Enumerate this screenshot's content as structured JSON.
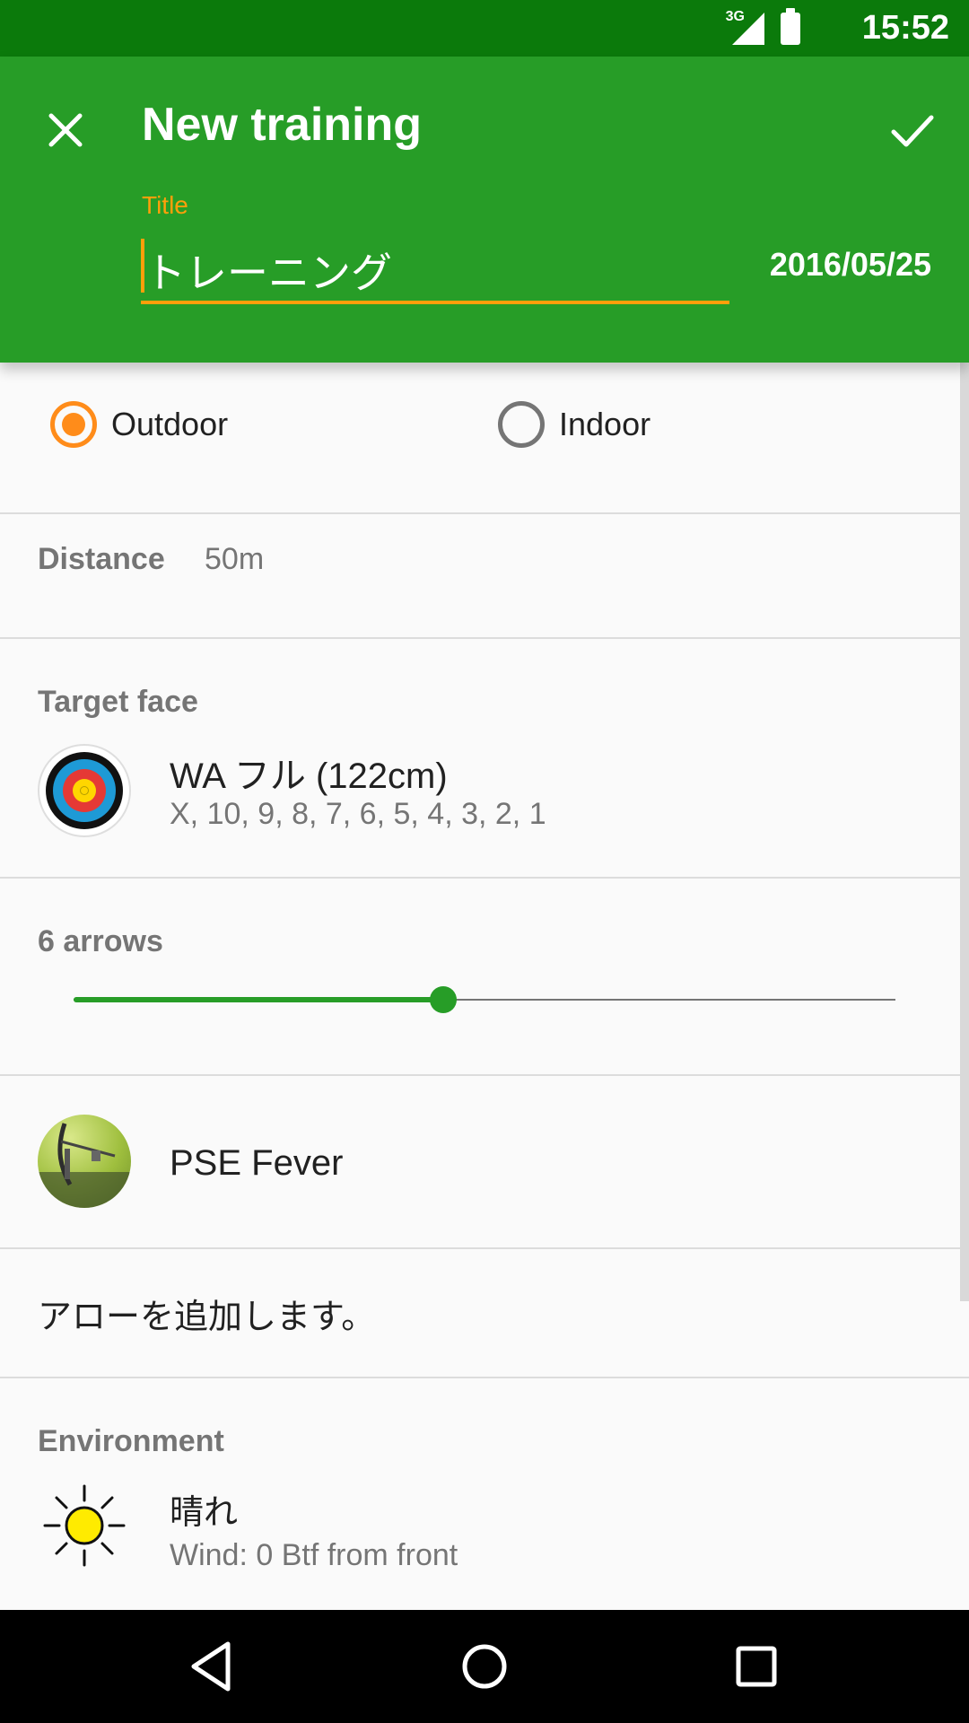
{
  "status_bar": {
    "network": "3G",
    "time": "15:52"
  },
  "app_bar": {
    "title": "New training",
    "title_label": "Title",
    "title_value": "トレーニング",
    "date": "2016/05/25"
  },
  "environment_type": {
    "options": [
      "Outdoor",
      "Indoor"
    ],
    "selected": "Outdoor"
  },
  "distance": {
    "label": "Distance",
    "value": "50m"
  },
  "target_face": {
    "label": "Target face",
    "name": "WA フル (122cm)",
    "scoring": "X, 10, 9, 8, 7, 6, 5, 4, 3, 2, 1"
  },
  "arrows": {
    "label": "6 arrows",
    "slider_fraction": 0.45
  },
  "bow": {
    "name": "PSE Fever"
  },
  "arrow_prompt": "アローを追加します。",
  "environment": {
    "label": "Environment",
    "weather": "晴れ",
    "wind": "Wind: 0 Btf from front"
  },
  "colors": {
    "app_bar": "#279d27",
    "status_bar": "#0b7a0b",
    "accent": "#ff9f0a",
    "radio_checked": "#ff8c1a"
  },
  "icons": [
    "close-icon",
    "check-icon",
    "sun-icon",
    "back-icon",
    "home-icon",
    "recent-apps-icon"
  ]
}
